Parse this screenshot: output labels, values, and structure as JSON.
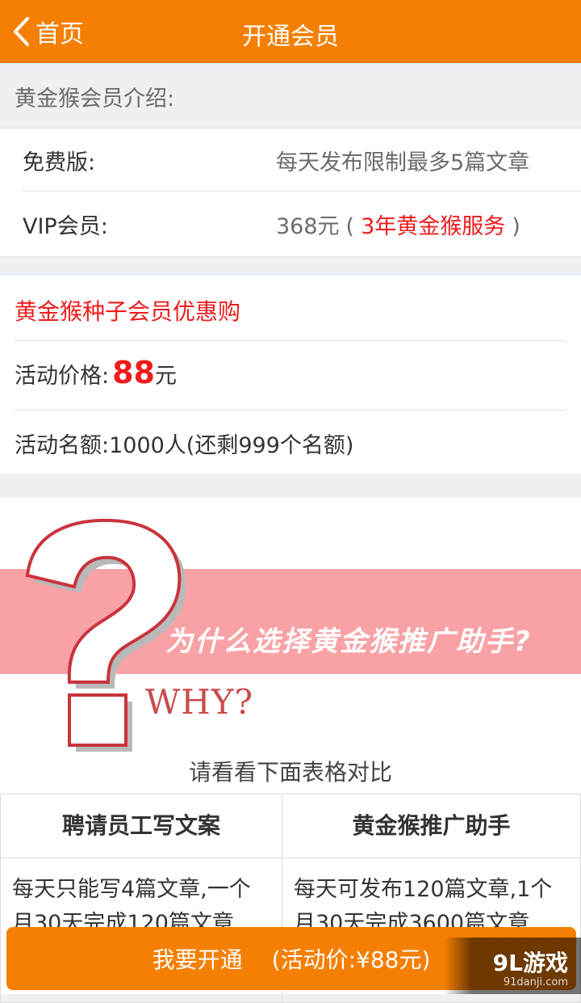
{
  "header": {
    "back_label": "首页",
    "title": "开通会员"
  },
  "intro": {
    "section_title": "黄金猴会员介绍:",
    "rows": [
      {
        "label": "免费版:",
        "value": "每天发布限制最多5篇文章"
      },
      {
        "label": "VIP会员:",
        "price": "368元",
        "paren_open": "(",
        "highlight": "3年黄金猴服务",
        "paren_close": ")"
      }
    ]
  },
  "promo": {
    "title": "黄金猴种子会员优惠购",
    "price_label": "活动价格:",
    "price_value": "88",
    "price_unit": "元",
    "quota_text": "活动名额:1000人(还剩999个名额)"
  },
  "banner": {
    "headline": "为什么选择黄金猴推广助手?",
    "why_text": "WHY?",
    "compare_hint": "请看看下面表格对比"
  },
  "table": {
    "headers": [
      "聘请员工写文案",
      "黄金猴推广助手"
    ],
    "cells": [
      "每天只能写4篇文章,一个月30天完成120篇文章",
      "每天可发布120篇文章,1个月30天完成3600篇文章"
    ]
  },
  "cta": {
    "label": "我要开通",
    "price_text": "(活动价:¥88元)"
  },
  "watermark": {
    "logo": "9L游戏",
    "url": "91danji.com"
  },
  "colors": {
    "brand_orange": "#f47f00",
    "highlight_red": "#ee1c1c",
    "banner_pink": "#f9a2a5"
  }
}
